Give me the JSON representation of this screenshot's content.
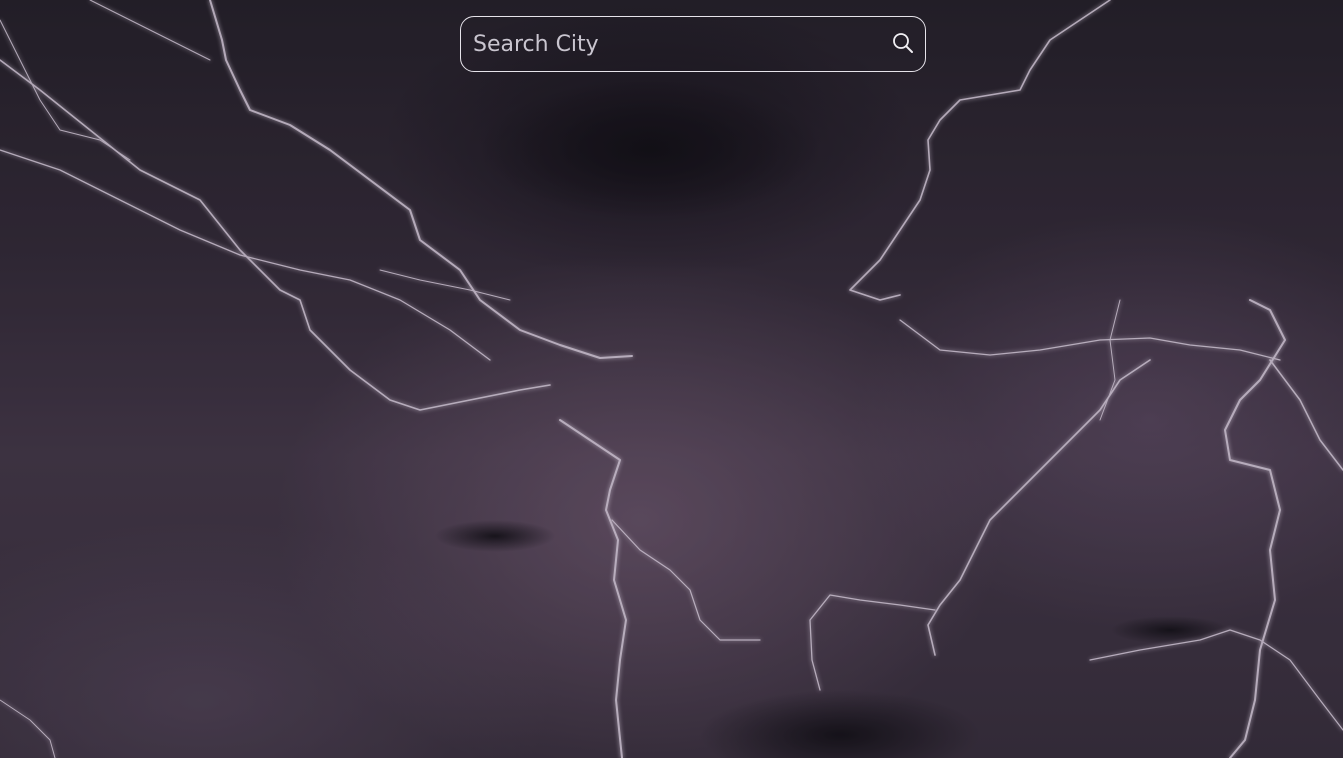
{
  "background": {
    "image": "lightning-storm-sky",
    "accent": "#e8d8f2"
  },
  "search": {
    "placeholder": "Search City",
    "value": "",
    "icon": "search-icon"
  }
}
